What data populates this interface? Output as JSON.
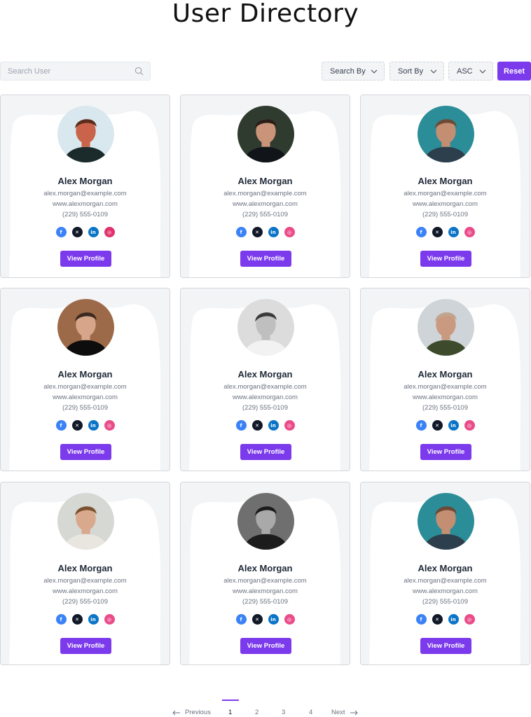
{
  "page": {
    "title": "User Directory"
  },
  "toolbar": {
    "search_placeholder": "Search User",
    "search_by": "Search By",
    "sort_by": "Sort By",
    "order": "ASC",
    "reset": "Reset"
  },
  "colors": {
    "accent": "#7c3aed",
    "facebook": "#3b82f6",
    "x": "#111827",
    "linkedin": "#0a74c7",
    "instagram": "#e1306c",
    "dribbble": "#ea4c89"
  },
  "cards": [
    {
      "name": "Alex Morgan",
      "email": "alex.morgan@example.com",
      "website": "www.alexmorgan.com",
      "phone": "(229) 555-0109",
      "socials": [
        "facebook-icon",
        "x-icon",
        "linkedin-icon",
        "instagram-icon"
      ],
      "button": "View Profile"
    },
    {
      "name": "Alex Morgan",
      "email": "alex.morgan@example.com",
      "website": "www.alexmorgan.com",
      "phone": "(229) 555-0109",
      "socials": [
        "facebook-icon",
        "x-icon",
        "linkedin-icon",
        "dribbble-icon"
      ],
      "button": "View Profile"
    },
    {
      "name": "Alex Morgan",
      "email": "alex.morgan@example.com",
      "website": "www.alexmorgan.com",
      "phone": "(229) 555-0109",
      "socials": [
        "facebook-icon",
        "x-icon",
        "linkedin-icon",
        "dribbble-icon"
      ],
      "button": "View Profile"
    },
    {
      "name": "Alex Morgan",
      "email": "alex.morgan@example.com",
      "website": "www.alexmorgan.com",
      "phone": "(229) 555-0109",
      "socials": [
        "facebook-icon",
        "x-icon",
        "linkedin-icon",
        "dribbble-icon"
      ],
      "button": "View Profile"
    },
    {
      "name": "Alex Morgan",
      "email": "alex.morgan@example.com",
      "website": "www.alexmorgan.com",
      "phone": "(229) 555-0109",
      "socials": [
        "facebook-icon",
        "x-icon",
        "linkedin-icon",
        "dribbble-icon"
      ],
      "button": "View Profile"
    },
    {
      "name": "Alex Morgan",
      "email": "alex.morgan@example.com",
      "website": "www.alexmorgan.com",
      "phone": "(229) 555-0109",
      "socials": [
        "facebook-icon",
        "x-icon",
        "linkedin-icon",
        "dribbble-icon"
      ],
      "button": "View Profile"
    },
    {
      "name": "Alex Morgan",
      "email": "alex.morgan@example.com",
      "website": "www.alexmorgan.com",
      "phone": "(229) 555-0109",
      "socials": [
        "facebook-icon",
        "x-icon",
        "linkedin-icon",
        "dribbble-icon"
      ],
      "button": "View Profile"
    },
    {
      "name": "Alex Morgan",
      "email": "alex.morgan@example.com",
      "website": "www.alexmorgan.com",
      "phone": "(229) 555-0109",
      "socials": [
        "facebook-icon",
        "x-icon",
        "linkedin-icon",
        "dribbble-icon"
      ],
      "button": "View Profile"
    },
    {
      "name": "Alex Morgan",
      "email": "alex.morgan@example.com",
      "website": "www.alexmorgan.com",
      "phone": "(229) 555-0109",
      "socials": [
        "facebook-icon",
        "x-icon",
        "linkedin-icon",
        "dribbble-icon"
      ],
      "button": "View Profile"
    }
  ],
  "pagination": {
    "previous": "Previous",
    "pages": [
      "1",
      "2",
      "3",
      "4"
    ],
    "current": "1",
    "next": "Next"
  }
}
